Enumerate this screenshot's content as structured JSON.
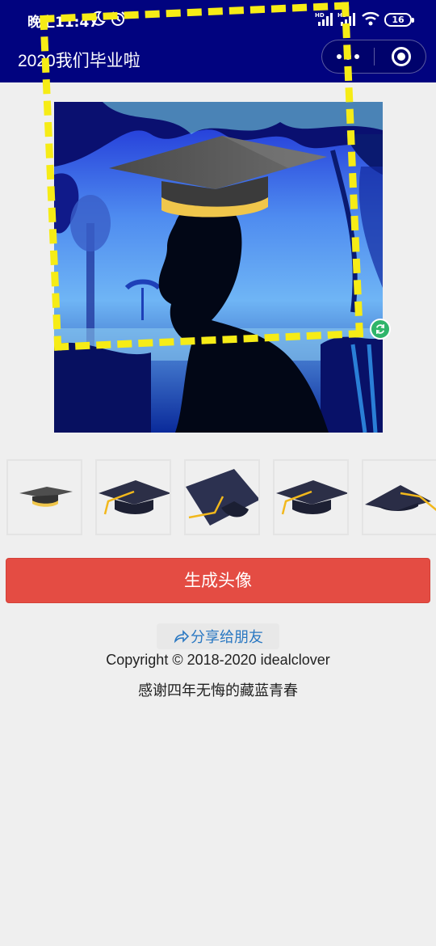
{
  "status_bar": {
    "time": "晚上11:47",
    "signal_1_label": "HD",
    "signal_2_label": "HD",
    "battery": "16",
    "icons": [
      "moon-icon",
      "alarm-icon",
      "signal-icon",
      "wifi-icon",
      "battery-icon"
    ]
  },
  "navbar": {
    "title": "2020我们毕业啦",
    "menu_icon": "more-dots-icon",
    "close_icon": "target-close-icon"
  },
  "editor": {
    "rotate_icon": "rotate-icon"
  },
  "hats": {
    "options": [
      "hat-1-gray-gold",
      "hat-2-navy-tassel",
      "hat-3-tilted-navy",
      "hat-4-navy-tassel",
      "hat-5-side-navy"
    ]
  },
  "actions": {
    "generate_label": "生成头像",
    "share_label": "分享给朋友"
  },
  "footer": {
    "copyright": "Copyright © 2018-2020  idealclover",
    "slogan": "感谢四年无悔的藏蓝青春"
  },
  "colors": {
    "header_bg": "#01037f",
    "accent_red": "#e44c43",
    "share_blue": "#2a78c2",
    "dash_yellow": "#f6ec16",
    "handle_green": "#2fb56a"
  }
}
